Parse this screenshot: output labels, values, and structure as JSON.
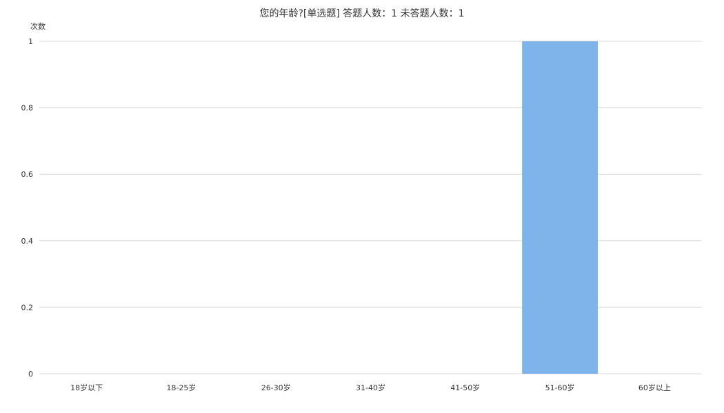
{
  "chart_data": {
    "type": "bar",
    "title": "您的年龄?[单选题]  答题人数：1  未答题人数：1",
    "xlabel": "",
    "ylabel": "次数",
    "categories": [
      "18岁以下",
      "18-25岁",
      "26-30岁",
      "31-40岁",
      "41-50岁",
      "51-60岁",
      "60岁以上"
    ],
    "values": [
      0,
      0,
      0,
      0,
      0,
      1,
      0
    ],
    "ylim": [
      0,
      1
    ],
    "yticks": [
      "0",
      "0.2",
      "0.4",
      "0.6",
      "0.8",
      "1"
    ],
    "ytick_values": [
      0,
      0.2,
      0.4,
      0.6,
      0.8,
      1
    ],
    "grid": true,
    "legend": "none",
    "bar_color": "#7eb4ea",
    "grid_color": "#d9d9d9"
  }
}
